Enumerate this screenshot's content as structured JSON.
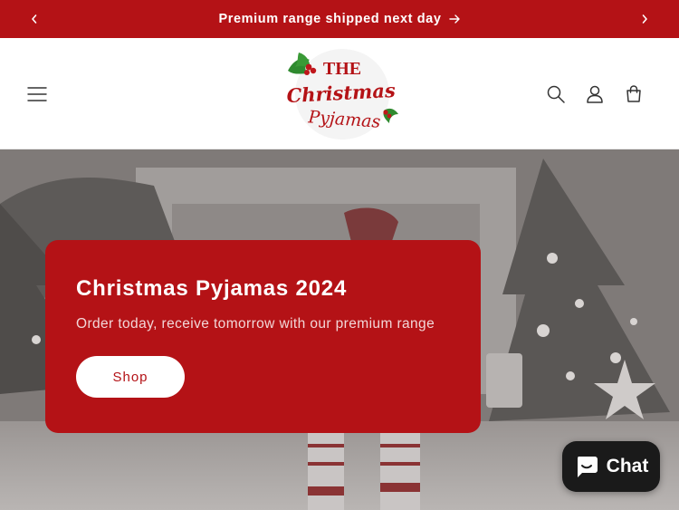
{
  "announcement": {
    "message": "Premium range shipped next day",
    "prev_icon": "chevron-left-icon",
    "next_icon": "chevron-right-icon",
    "background": "#b41216"
  },
  "header": {
    "logo": {
      "line1": "THE",
      "line2": "Christmas",
      "line3": "Pyjamas"
    },
    "icons": [
      "menu-icon",
      "search-icon",
      "account-icon",
      "cart-icon"
    ]
  },
  "hero": {
    "title": "Christmas Pyjamas 2024",
    "subtitle": "Order today, receive tomorrow with our premium range",
    "cta_label": "Shop",
    "accent": "#b41216"
  },
  "chat": {
    "label": "Chat",
    "icon": "chat-bubble-icon"
  }
}
